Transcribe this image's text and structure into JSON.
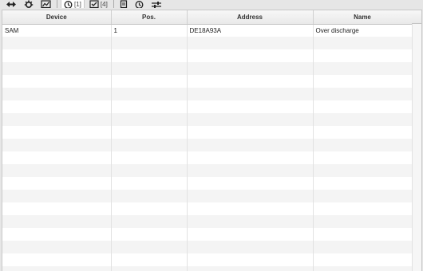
{
  "toolbar": {
    "items": [
      {
        "icon": "arrows-icon"
      },
      {
        "icon": "gear-icon"
      },
      {
        "icon": "chart-icon"
      },
      {
        "icon": "clock-icon",
        "count": "[1]",
        "active": true
      },
      {
        "icon": "checkbox-icon",
        "count": "[4]"
      },
      {
        "icon": "document-icon"
      },
      {
        "icon": "clock-icon"
      },
      {
        "icon": "sliders-icon"
      }
    ]
  },
  "table": {
    "columns": [
      "Device",
      "Pos.",
      "Address",
      "Name"
    ],
    "rows": [
      [
        "SAM",
        "1",
        "DE18A93A",
        "Over discharge"
      ]
    ]
  }
}
